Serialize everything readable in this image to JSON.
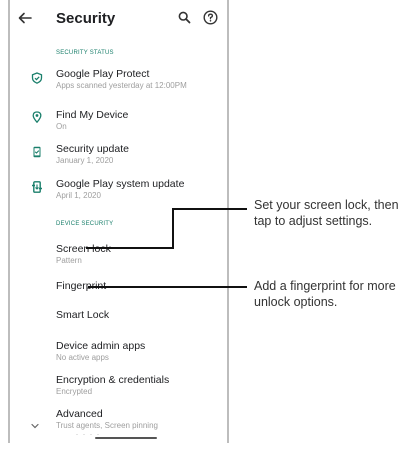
{
  "appbar": {
    "title": "Security",
    "back_icon": "arrow-back-icon",
    "search_icon": "search-icon",
    "help_icon": "help-icon"
  },
  "sections": {
    "status_header": "SECURITY STATUS",
    "device_header": "DEVICE SECURITY"
  },
  "status_items": [
    {
      "label": "Google Play Protect",
      "sub": "Apps scanned yesterday at 12:00PM",
      "icon": "shield-check-icon"
    },
    {
      "label": "Find My Device",
      "sub": "On",
      "icon": "location-pin-icon"
    },
    {
      "label": "Security update",
      "sub": "January 1, 2020",
      "icon": "phone-check-icon"
    },
    {
      "label": "Google Play system update",
      "sub": "April 1, 2020",
      "icon": "system-update-icon"
    }
  ],
  "device_items": [
    {
      "label": "Screen lock",
      "sub": "Pattern"
    },
    {
      "label": "Fingerprint",
      "sub": ""
    },
    {
      "label": "Smart Lock",
      "sub": ""
    },
    {
      "label": "Device admin apps",
      "sub": "No active apps"
    },
    {
      "label": "Encryption & credentials",
      "sub": "Encrypted"
    },
    {
      "label": "Advanced",
      "sub": "Trust agents, Screen pinning"
    }
  ],
  "callouts": {
    "screen_lock_line1": "Set your screen lock, then",
    "screen_lock_line2": "tap to adjust settings.",
    "fingerprint_line1": "Add a fingerprint for more",
    "fingerprint_line2": "unlock options."
  },
  "colors": {
    "accent": "#1a7f6b",
    "secondary_text": "#9e9e9e"
  }
}
